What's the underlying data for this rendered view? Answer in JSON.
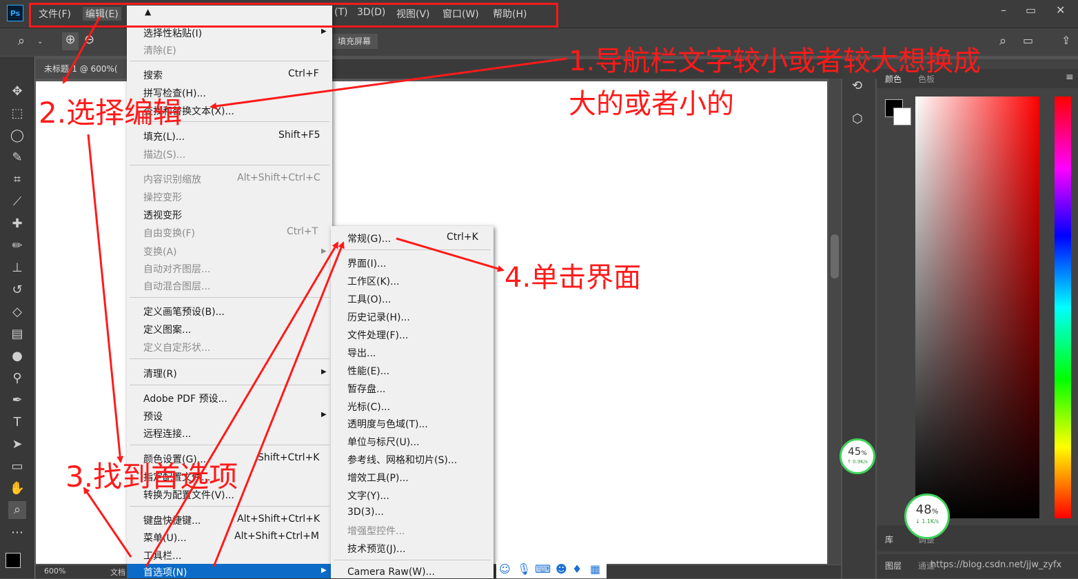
{
  "menubar": {
    "logo": "Ps",
    "items": [
      "文件(F)",
      "编辑(E)",
      "(T)",
      "3D(D)",
      "视图(V)",
      "窗口(W)",
      "帮助(H)"
    ],
    "window_controls": [
      "–",
      "▭",
      "✕"
    ]
  },
  "optionsbar": {
    "fill_screen": "填充屏幕"
  },
  "document": {
    "tab_label": "未标题-1 @ 600%(",
    "zoom": "600%",
    "status_doc": "文档"
  },
  "edit_menu": {
    "items": [
      {
        "label": "选择性粘贴(I)",
        "disabled": false,
        "submenu": true
      },
      {
        "label": "清除(E)",
        "disabled": true
      },
      {
        "label": "搜索",
        "shortcut": "Ctrl+F"
      },
      {
        "label": "拼写检查(H)..."
      },
      {
        "label": "查找和替换文本(X)..."
      },
      {
        "label": "填充(L)...",
        "shortcut": "Shift+F5"
      },
      {
        "label": "描边(S)...",
        "disabled": true
      },
      {
        "label": "内容识别缩放",
        "shortcut": "Alt+Shift+Ctrl+C",
        "disabled": true
      },
      {
        "label": "操控变形",
        "disabled": true
      },
      {
        "label": "透视变形"
      },
      {
        "label": "自由变换(F)",
        "shortcut": "Ctrl+T",
        "disabled": true
      },
      {
        "label": "变换(A)",
        "disabled": true,
        "submenu": true
      },
      {
        "label": "自动对齐图层...",
        "disabled": true
      },
      {
        "label": "自动混合图层...",
        "disabled": true
      },
      {
        "label": "定义画笔预设(B)..."
      },
      {
        "label": "定义图案..."
      },
      {
        "label": "定义自定形状...",
        "disabled": true
      },
      {
        "label": "清理(R)",
        "submenu": true
      },
      {
        "label": "Adobe PDF 预设..."
      },
      {
        "label": "预设",
        "submenu": true
      },
      {
        "label": "远程连接..."
      },
      {
        "label": "颜色设置(G)...",
        "shortcut": "Shift+Ctrl+K"
      },
      {
        "label": "指定配置文件..."
      },
      {
        "label": "转换为配置文件(V)..."
      },
      {
        "label": "键盘快捷键...",
        "shortcut": "Alt+Shift+Ctrl+K"
      },
      {
        "label": "菜单(U)...",
        "shortcut": "Alt+Shift+Ctrl+M"
      },
      {
        "label": "工具栏..."
      },
      {
        "label": "首选项(N)",
        "submenu": true,
        "highlighted": true
      }
    ]
  },
  "preferences_submenu": {
    "items": [
      {
        "label": "常规(G)...",
        "shortcut": "Ctrl+K"
      },
      {
        "label": "界面(I)..."
      },
      {
        "label": "工作区(K)..."
      },
      {
        "label": "工具(O)..."
      },
      {
        "label": "历史记录(H)..."
      },
      {
        "label": "文件处理(F)..."
      },
      {
        "label": "导出..."
      },
      {
        "label": "性能(E)..."
      },
      {
        "label": "暂存盘..."
      },
      {
        "label": "光标(C)..."
      },
      {
        "label": "透明度与色域(T)..."
      },
      {
        "label": "单位与标尺(U)..."
      },
      {
        "label": "参考线、网格和切片(S)..."
      },
      {
        "label": "增效工具(P)..."
      },
      {
        "label": "文字(Y)..."
      },
      {
        "label": "3D(3)..."
      },
      {
        "label": "增强型控件...",
        "disabled": true
      },
      {
        "label": "技术预览(J)..."
      },
      {
        "label": "Camera Raw(W)..."
      }
    ]
  },
  "right_panel": {
    "tabs": [
      "颜色",
      "色板"
    ],
    "bottom_tabs": [
      "库",
      "调整",
      "图层",
      "通道"
    ]
  },
  "annotations": {
    "step1_line1": "1.导航栏文字较小或者较大想换成",
    "step1_line2": "大的或者小的",
    "step2": "2.选择编辑",
    "step3": "3.找到首选项",
    "step4": "4.单击界面",
    "color": "#ff1a1a"
  },
  "speed_widgets": [
    {
      "percent": "45",
      "unit": "%",
      "rate": "↑ 0.9K/s"
    },
    {
      "percent": "48",
      "unit": "%",
      "rate": "↓ 1.1K/s"
    }
  ],
  "watermark": "https://blog.csdn.net/jjw_zyfx"
}
